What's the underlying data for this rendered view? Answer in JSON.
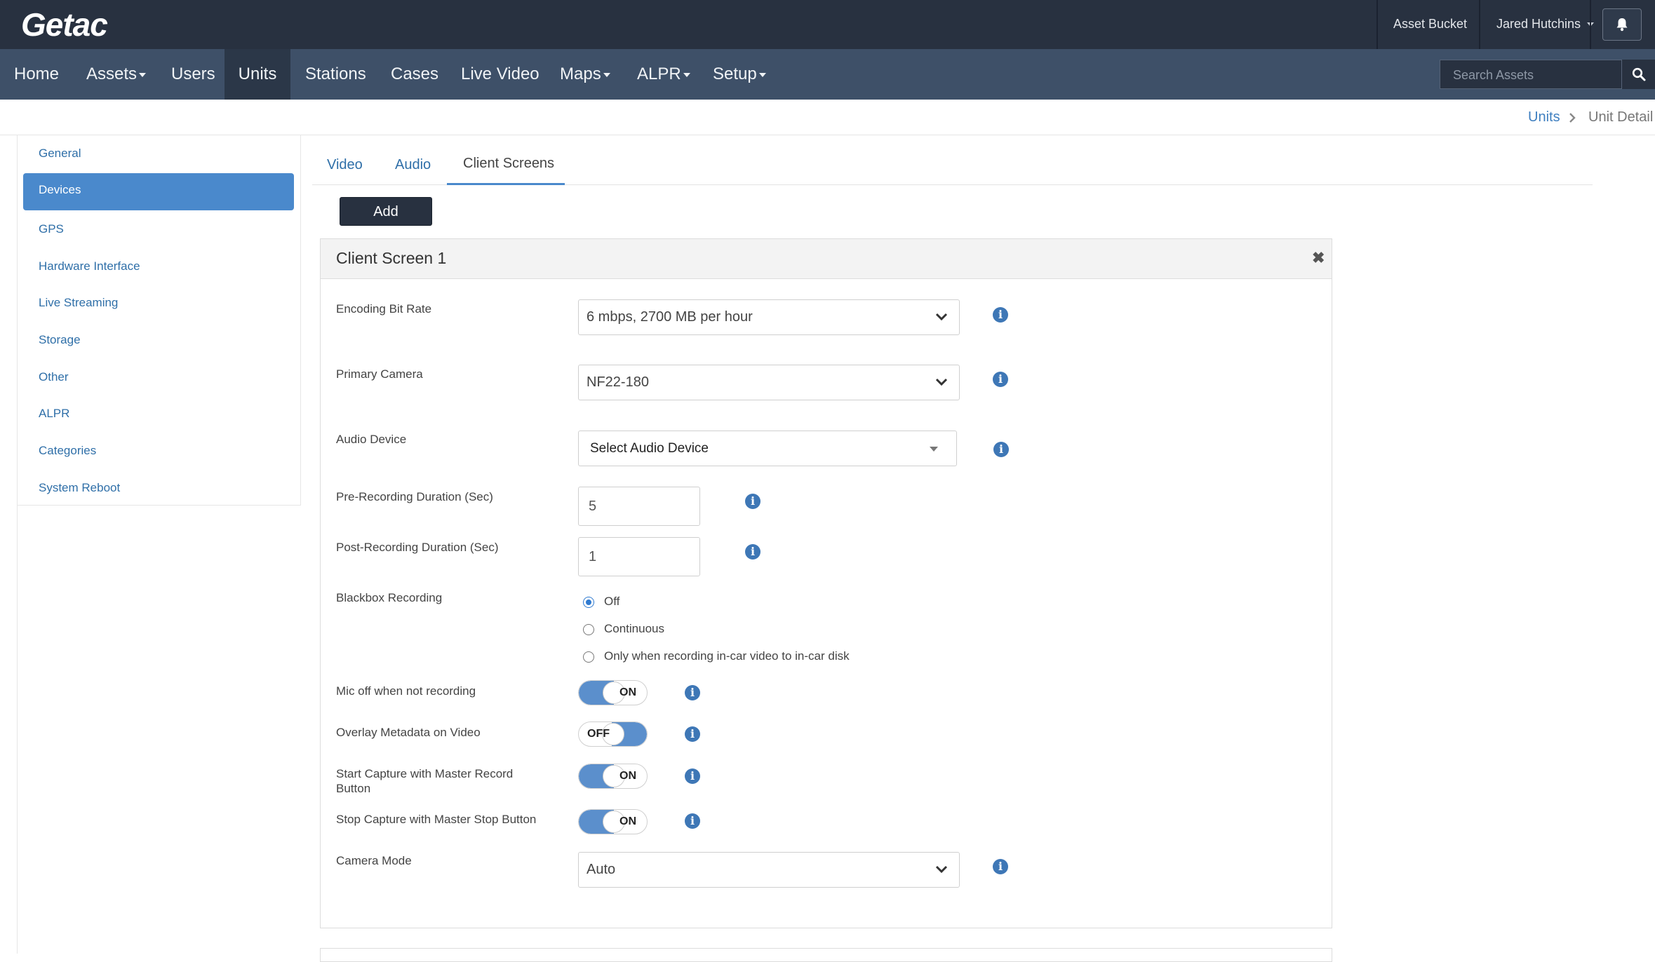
{
  "header": {
    "logo": "Getac",
    "asset_bucket": "Asset Bucket",
    "user_name": "Jared Hutchins"
  },
  "nav": {
    "items": [
      "Home",
      "Assets",
      "Users",
      "Units",
      "Stations",
      "Cases",
      "Live Video",
      "Maps",
      "ALPR",
      "Setup"
    ],
    "active": "Units",
    "search_placeholder": "Search Assets"
  },
  "breadcrumb": {
    "items": [
      "Units",
      "Unit Detail"
    ]
  },
  "sidebar": {
    "items": [
      "General",
      "Devices",
      "GPS",
      "Hardware Interface",
      "Live Streaming",
      "Storage",
      "Other",
      "ALPR",
      "Categories",
      "System Reboot"
    ],
    "active": "Devices"
  },
  "tabs": {
    "items": [
      "Video",
      "Audio",
      "Client Screens"
    ],
    "active": "Client Screens"
  },
  "add_label": "Add",
  "panel": {
    "title": "Client Screen 1",
    "encoding_bit_rate": {
      "label": "Encoding Bit Rate",
      "value": "6 mbps, 2700 MB per hour"
    },
    "primary_camera": {
      "label": "Primary Camera",
      "value": "NF22-180"
    },
    "audio_device": {
      "label": "Audio Device",
      "value": "Select Audio Device"
    },
    "pre_recording": {
      "label": "Pre-Recording Duration (Sec)",
      "value": "5"
    },
    "post_recording": {
      "label": "Post-Recording Duration (Sec)",
      "value": "1"
    },
    "blackbox": {
      "label": "Blackbox Recording",
      "options": [
        "Off",
        "Continuous",
        "Only when recording in-car video to in-car disk"
      ],
      "selected": "Off"
    },
    "mic_off": {
      "label": "Mic off when not recording",
      "state": "ON"
    },
    "overlay_metadata": {
      "label": "Overlay Metadata on Video",
      "state": "OFF"
    },
    "start_capture": {
      "label": "Start Capture with Master Record Button",
      "state": "ON"
    },
    "stop_capture": {
      "label": "Stop Capture with Master Stop Button",
      "state": "ON"
    },
    "camera_mode": {
      "label": "Camera Mode",
      "value": "Auto"
    }
  },
  "colors": {
    "topbar": "#283140",
    "navbar": "#3e5068",
    "accent": "#4a89cc",
    "link": "#2f6fa8",
    "info_icon": "#3e77b6"
  }
}
